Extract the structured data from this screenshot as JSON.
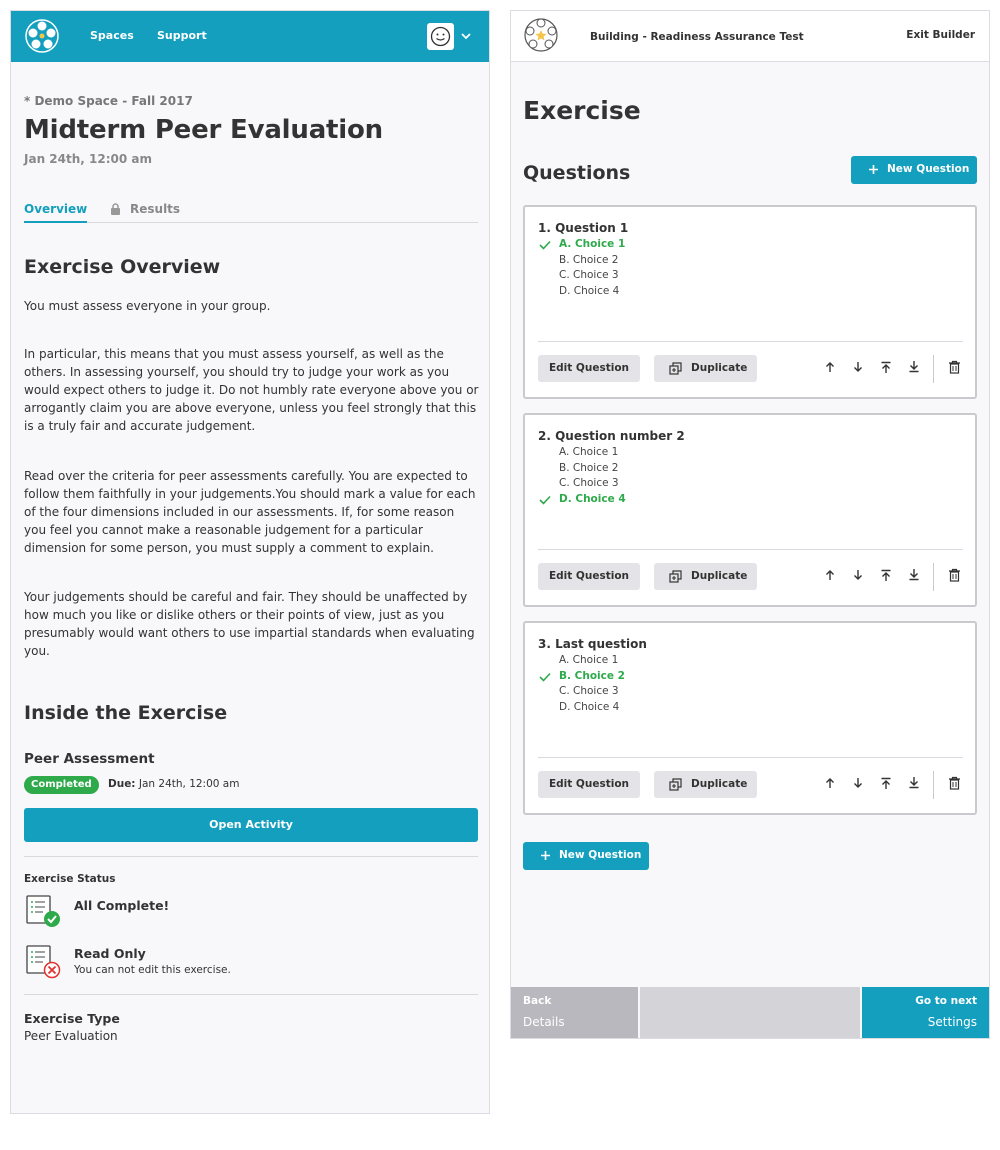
{
  "colors": {
    "accent": "#139fbd",
    "success": "#2eaa4a",
    "danger": "#e0322f"
  },
  "left": {
    "nav": {
      "spaces": "Spaces",
      "support": "Support",
      "logo": "app-logo-icon",
      "avatar": "smiley-avatar-icon"
    },
    "breadcrumb": "* Demo Space - Fall 2017",
    "title": "Midterm Peer Evaluation",
    "date": "Jan 24th, 12:00 am",
    "tabs": {
      "overview": "Overview",
      "results": "Results"
    },
    "overview": {
      "heading": "Exercise Overview",
      "paragraphs": [
        "You must assess everyone in your group.",
        "In particular, this means that you must assess yourself, as well as the others. In assessing yourself, you should try to judge your work as you would expect others to judge it. Do not humbly rate everyone above you or arrogantly claim you are above everyone, unless you feel strongly that this is a truly fair and accurate judgement.",
        "Read over the criteria for peer assessments carefully. You are expected to follow them faithfully in your judgements.You should mark a value for each of the four dimensions included in our assessments. If, for some reason you feel you cannot make a reasonable judgement for a particular dimension for some person, you must supply a comment to explain.",
        "Your judgements should be careful and fair. They should be unaffected by how much you like or dislike others or their points of view, just as you presumably would want others to use impartial standards when evaluating you."
      ]
    },
    "inside": {
      "heading": "Inside the Exercise",
      "activity_name": "Peer Assessment",
      "badge": "Completed",
      "due_label": "Due:",
      "due_value": "Jan 24th, 12:00 am",
      "open_button": "Open Activity"
    },
    "status": {
      "heading": "Exercise Status",
      "complete_title": "All Complete!",
      "readonly_title": "Read Only",
      "readonly_desc": "You can not edit this exercise."
    },
    "type": {
      "label": "Exercise Type",
      "value": "Peer Evaluation"
    }
  },
  "right": {
    "builder_title": "Building - Readiness Assurance Test",
    "exit": "Exit Builder",
    "exercise_title": "Exercise",
    "questions_heading": "Questions",
    "new_question": "New Question",
    "edit_label": "Edit Question",
    "duplicate_label": "Duplicate",
    "questions": [
      {
        "title": "1. Question 1",
        "choices": [
          "A. Choice 1",
          "B. Choice 2",
          "C. Choice 3",
          "D. Choice 4"
        ],
        "correct": 0
      },
      {
        "title": "2. Question number 2",
        "choices": [
          "A. Choice 1",
          "B. Choice 2",
          "C. Choice 3",
          "D. Choice 4"
        ],
        "correct": 3
      },
      {
        "title": "3. Last question",
        "choices": [
          "A. Choice 1",
          "B. Choice 2",
          "C. Choice 3",
          "D. Choice 4"
        ],
        "correct": 1
      }
    ],
    "footer": {
      "back": "Back",
      "back_sub": "Details",
      "next": "Go to next",
      "next_sub": "Settings"
    }
  }
}
